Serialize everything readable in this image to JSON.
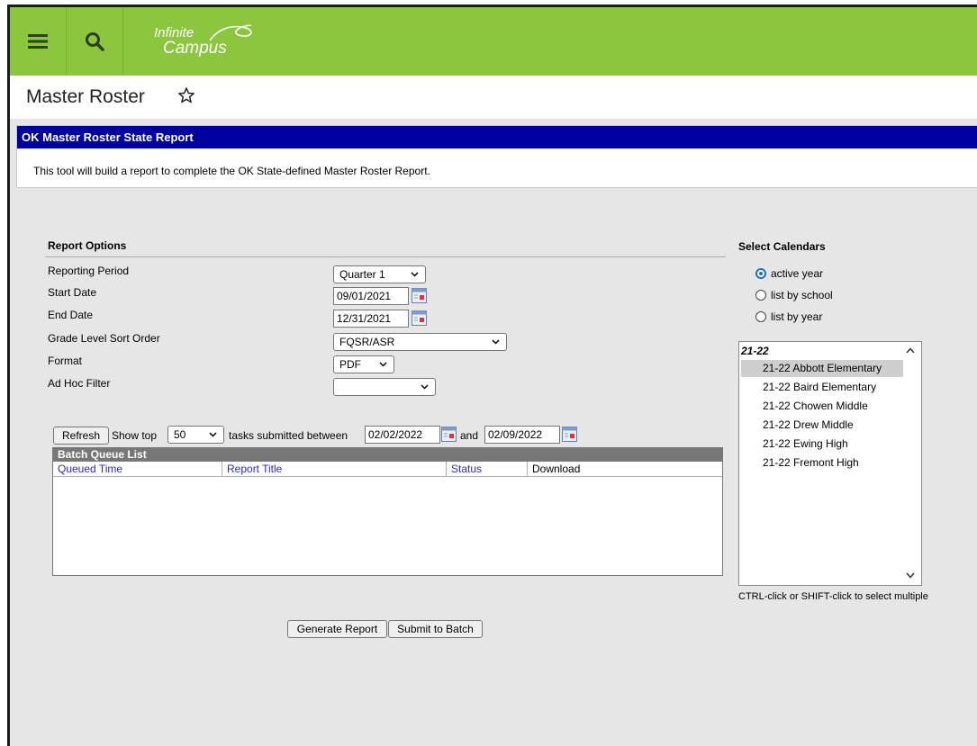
{
  "header": {
    "logo_line1": "Infinite",
    "logo_line2": "Campus"
  },
  "page": {
    "title": "Master Roster"
  },
  "report_panel": {
    "heading": "OK Master Roster State Report",
    "description": "This tool will build a report to complete the OK State-defined Master Roster Report."
  },
  "report_options": {
    "title": "Report Options",
    "reporting_period_label": "Reporting Period",
    "reporting_period_value": "Quarter 1",
    "start_date_label": "Start Date",
    "start_date_value": "09/01/2021",
    "end_date_label": "End Date",
    "end_date_value": "12/31/2021",
    "grade_sort_label": "Grade Level Sort Order",
    "grade_sort_value": "FQSR/ASR",
    "format_label": "Format",
    "format_value": "PDF",
    "adhoc_label": "Ad Hoc Filter",
    "adhoc_value": ""
  },
  "batch": {
    "refresh_label": "Refresh",
    "show_top_label": "Show top",
    "show_top_value": "50",
    "between_label": "tasks submitted between",
    "from_date": "02/02/2022",
    "and_label": "and",
    "to_date": "02/09/2022",
    "list_title": "Batch Queue List",
    "columns": [
      "Queued Time",
      "Report Title",
      "Status",
      "Download"
    ]
  },
  "actions": {
    "generate_label": "Generate Report",
    "submit_label": "Submit to Batch"
  },
  "calendars": {
    "title": "Select Calendars",
    "radios": [
      "active year",
      "list by school",
      "list by year"
    ],
    "group_label": "21-22",
    "items": [
      "21-22 Abbott Elementary",
      "21-22 Baird Elementary",
      "21-22 Chowen Middle",
      "21-22 Drew Middle",
      "21-22 Ewing High",
      "21-22 Fremont High"
    ],
    "hint": "CTRL-click or SHIFT-click to select multiple"
  },
  "colors": {
    "topbar": "#8cc63f",
    "panel_header": "#0000a0",
    "link_blue": "#2a2ad8",
    "radio_blue": "#1a6fd1"
  }
}
